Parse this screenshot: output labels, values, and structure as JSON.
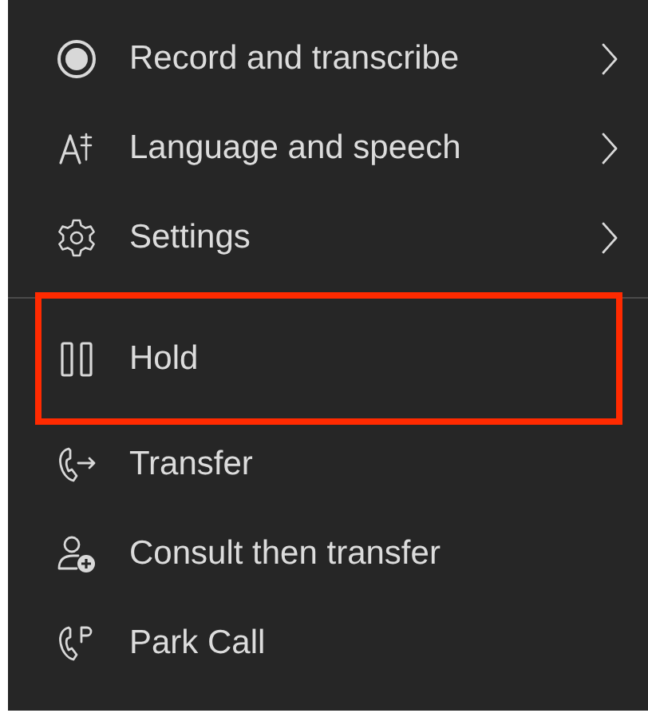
{
  "menu": {
    "sections": [
      {
        "items": [
          {
            "kind": "record",
            "label": "Record and transcribe",
            "has_submenu": true,
            "highlighted": false
          },
          {
            "kind": "language",
            "label": "Language and speech",
            "has_submenu": true,
            "highlighted": false
          },
          {
            "kind": "settings",
            "label": "Settings",
            "has_submenu": true,
            "highlighted": false
          }
        ]
      },
      {
        "items": [
          {
            "kind": "hold",
            "label": "Hold",
            "has_submenu": false,
            "highlighted": true
          },
          {
            "kind": "transfer",
            "label": "Transfer",
            "has_submenu": false,
            "highlighted": false
          },
          {
            "kind": "consult",
            "label": "Consult then transfer",
            "has_submenu": false,
            "highlighted": false
          },
          {
            "kind": "park",
            "label": "Park Call",
            "has_submenu": false,
            "highlighted": false
          }
        ]
      }
    ]
  }
}
